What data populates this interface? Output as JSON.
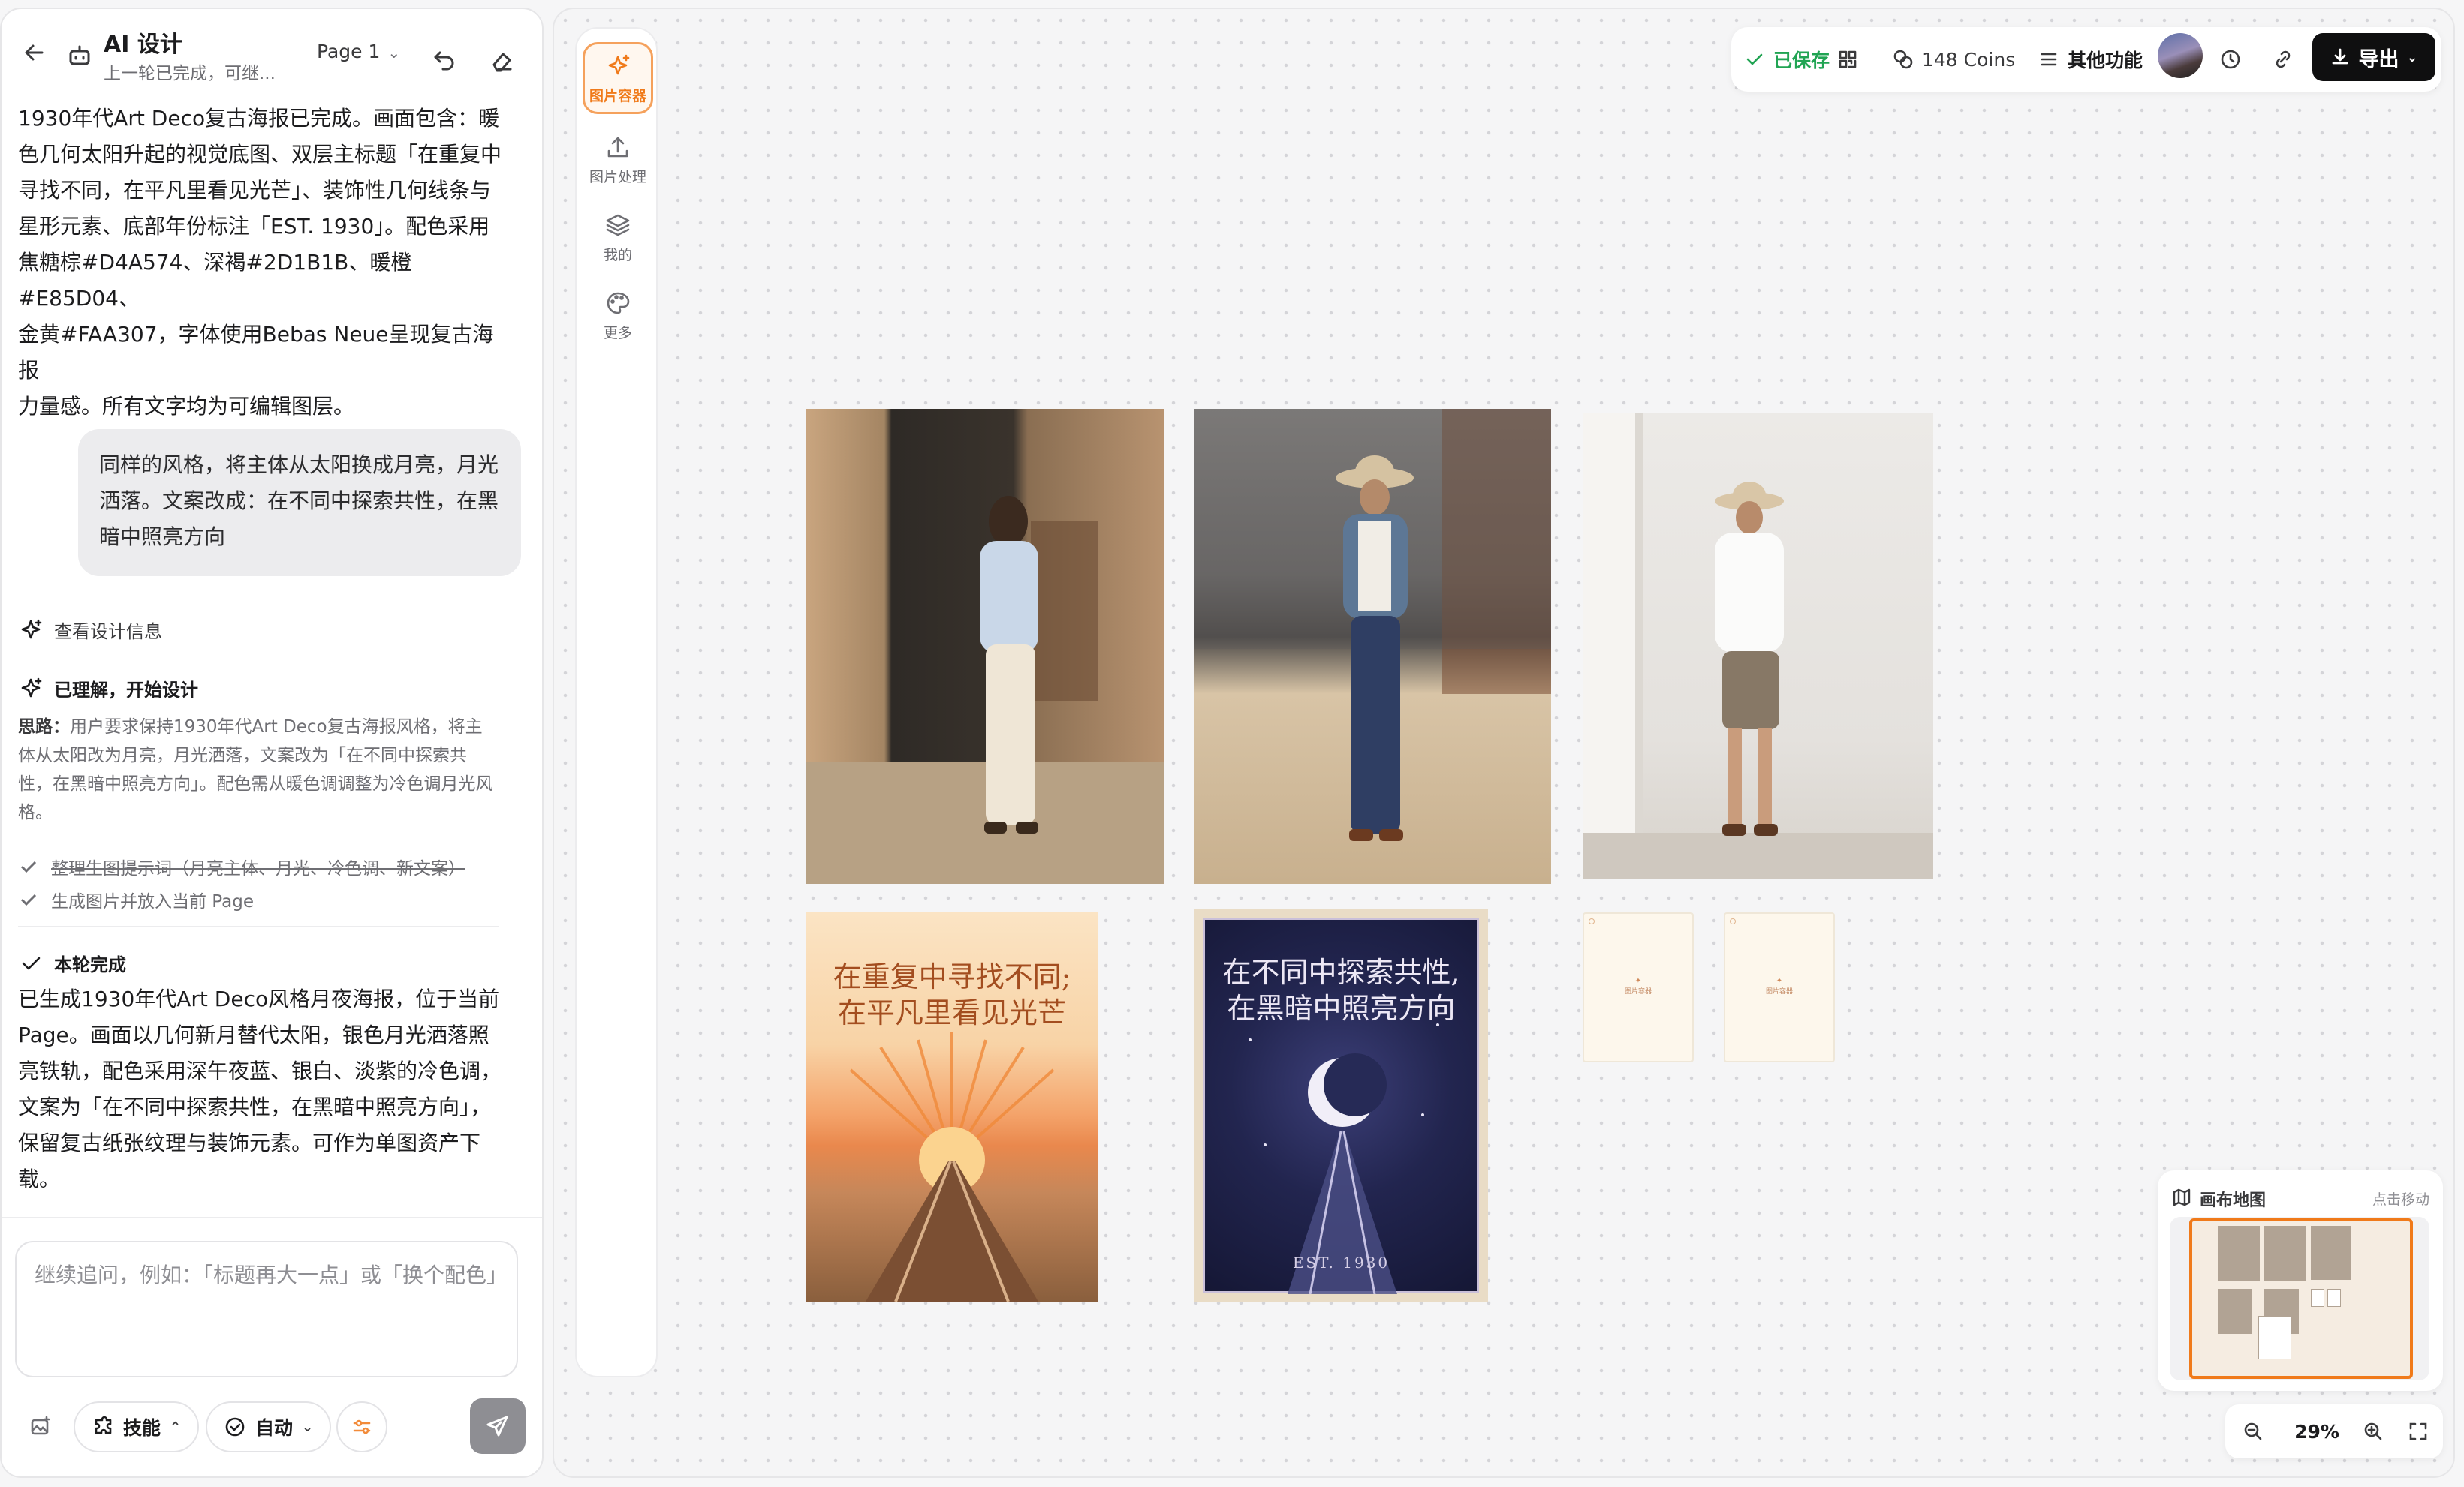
{
  "header": {
    "title": "AI 设计",
    "subtitle": "上一轮已完成，可继...",
    "page_selector": "Page 1"
  },
  "chat": {
    "assistant_intro": [
      "1930年代Art Deco复古海报已完成。画面包含：暖",
      "色几何太阳升起的视觉底图、双层主标题「在重复中",
      "寻找不同，在平凡里看见光芒」、装饰性几何线条与",
      "星形元素、底部年份标注「EST. 1930」。配色采用",
      "焦糖棕#D4A574、深褐#2D1B1B、暖橙#E85D04、",
      "金黄#FAA307，字体使用Bebas Neue呈现复古海报",
      "力量感。所有文字均为可编辑图层。"
    ],
    "user_message": [
      "同样的风格，将主体从太阳换成月亮，月光",
      "洒落。文案改成：在不同中探索共性，在黑",
      "暗中照亮方向"
    ],
    "view_design_info": "查看设计信息",
    "understood": "已理解，开始设计",
    "thinking_label": "思路：",
    "thinking_text": "用户要求保持1930年代Art Deco复古海报风格，将主体从太阳改为月亮，月光洒落，文案改为「在不同中探索共性，在黑暗中照亮方向」。配色需从暖色调调整为冷色调月光风格。",
    "todo_1": "整理生图提示词（月亮主体、月光、冷色调、新文案）",
    "todo_2": "生成图片并放入当前 Page",
    "round_done": "本轮完成",
    "result_text": [
      "已生成1930年代Art Deco风格月夜海报，位于当前",
      "Page。画面以几何新月替代太阳，银色月光洒落照",
      "亮铁轨，配色采用深午夜蓝、银白、淡紫的冷色调，",
      "文案为「在不同中探索共性，在黑暗中照亮方向」，",
      "保留复古纸张纹理与装饰元素。可作为单图资产下",
      "载。"
    ],
    "input_placeholder": "继续追问，例如：「标题再大一点」或「换个配色」",
    "skill_label": "技能",
    "auto_label": "自动"
  },
  "toolbar": {
    "items": [
      {
        "label": "图片容器",
        "icon": "sparkle-icon",
        "active": true
      },
      {
        "label": "图片处理",
        "icon": "upload-icon",
        "active": false
      },
      {
        "label": "我的",
        "icon": "layers-icon",
        "active": false
      },
      {
        "label": "更多",
        "icon": "palette-icon",
        "active": false
      }
    ]
  },
  "topbar": {
    "saved": "已保存",
    "coins": "148 Coins",
    "more_features": "其他功能",
    "export": "导出"
  },
  "canvas": {
    "poster_sun_title": [
      "在重复中寻找不同;",
      "在平凡里看见光芒"
    ],
    "poster_moon_title": [
      "在不同中探索共性,",
      "在黑暗中照亮方向"
    ],
    "poster_moon_footer": "EST. 1930",
    "placeholder_label": "图片容器"
  },
  "minimap": {
    "title": "画布地图",
    "hint": "点击移动"
  },
  "zoom": {
    "value": "29%"
  },
  "colors": {
    "accent": "#f07a1a",
    "saved_green": "#21a453",
    "export_bg": "#0f0f10"
  }
}
